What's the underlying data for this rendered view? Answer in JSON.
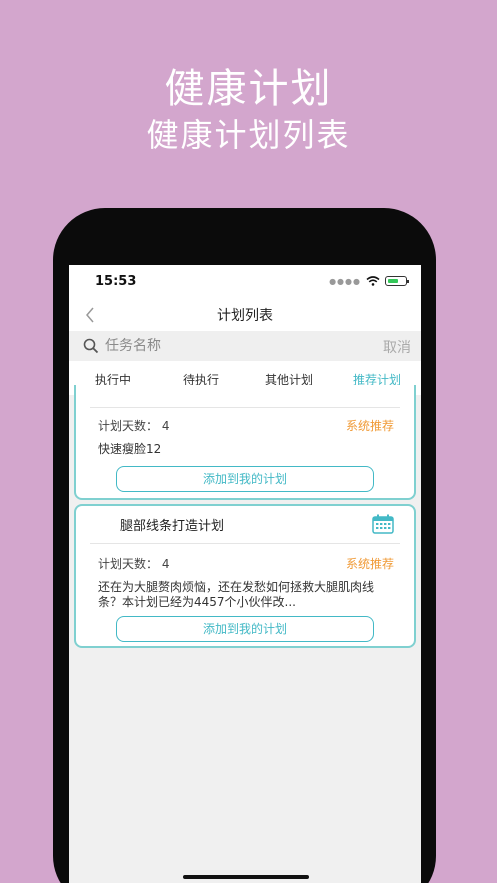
{
  "promo": {
    "title": "健康计划",
    "subtitle": "健康计划列表"
  },
  "status_bar": {
    "time": "15:53"
  },
  "nav": {
    "title": "计划列表"
  },
  "search": {
    "placeholder": "任务名称",
    "cancel_label": "取消"
  },
  "tabs": [
    {
      "label": "执行中",
      "active": false
    },
    {
      "label": "待执行",
      "active": false
    },
    {
      "label": "其他计划",
      "active": false
    },
    {
      "label": "推荐计划",
      "active": true
    }
  ],
  "cards": [
    {
      "days_label": "计划天数：  4",
      "badge": "系统推荐",
      "description": "快速瘦脸12",
      "button_label": "添加到我的计划"
    },
    {
      "title": "腿部线条打造计划",
      "days_label": "计划天数：  4",
      "badge": "系统推荐",
      "description": "还在为大腿赘肉烦恼，还在发愁如何拯救大腿肌肉线条？本计划已经为4457个小伙伴改...",
      "button_label": "添加到我的计划"
    }
  ],
  "colors": {
    "background": "#d3a6cd",
    "accent": "#43b9c6",
    "card_border": "#7fd0d0",
    "badge": "#f09a36"
  }
}
